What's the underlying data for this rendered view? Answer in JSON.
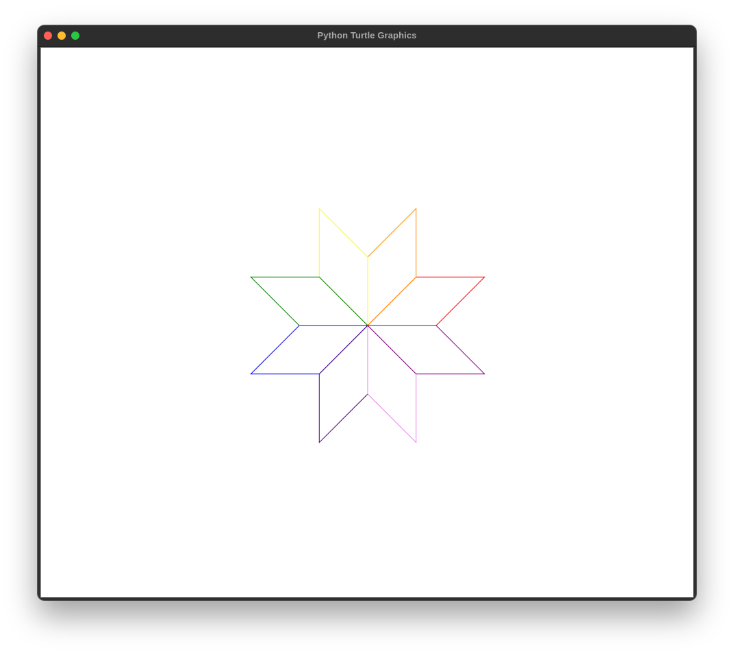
{
  "window": {
    "title": "Python Turtle Graphics"
  },
  "colors": {
    "titlebar": "#2d2d2d",
    "title_text": "#a9a9a9",
    "close": "#fe5f57",
    "minimize": "#febc2e",
    "zoom": "#28c840",
    "canvas_bg": "#ffffff"
  },
  "drawing": {
    "shape": "eight-point star of rhombi",
    "center": [
      0,
      0
    ],
    "side_length": 100,
    "rhombi": [
      {
        "name": "red",
        "color": "#ff0000",
        "heading": 0
      },
      {
        "name": "orange",
        "color": "#ff8c00",
        "heading": 45
      },
      {
        "name": "yellow",
        "color": "#ffff00",
        "heading": 90
      },
      {
        "name": "green",
        "color": "#008000",
        "heading": 135
      },
      {
        "name": "blue",
        "color": "#0000ff",
        "heading": 180
      },
      {
        "name": "indigo",
        "color": "#4b0082",
        "heading": 225
      },
      {
        "name": "violet",
        "color": "#ee82ee",
        "heading": 270
      },
      {
        "name": "purple",
        "color": "#800080",
        "heading": 315
      }
    ]
  }
}
